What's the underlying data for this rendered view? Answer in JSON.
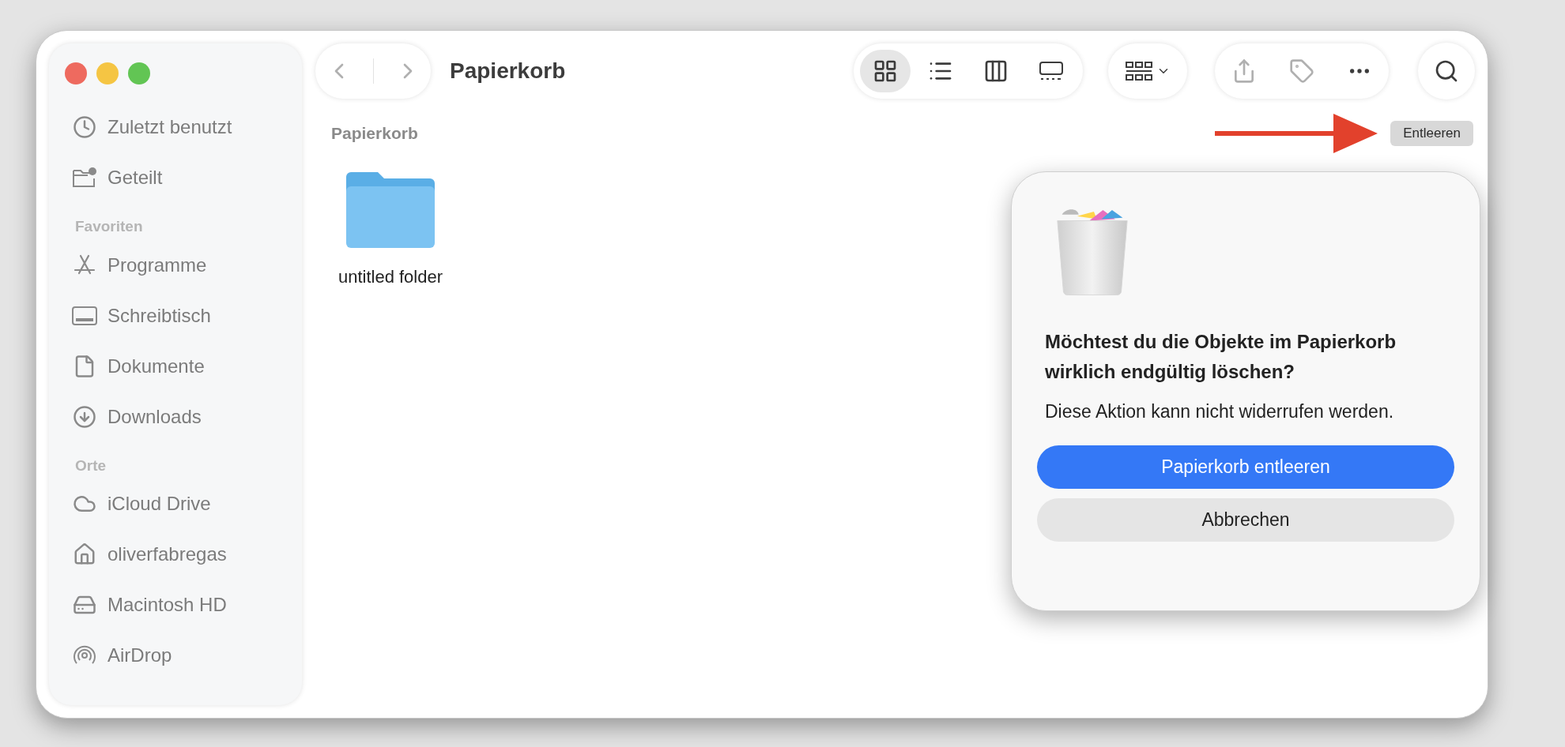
{
  "window": {
    "title": "Papierkorb"
  },
  "toolbar": {
    "view_modes": [
      {
        "selected": true
      },
      {
        "selected": false
      },
      {
        "selected": false
      },
      {
        "selected": false
      }
    ]
  },
  "sidebar": {
    "top_items": [
      {
        "label": "Zuletzt benutzt"
      },
      {
        "label": "Geteilt"
      }
    ],
    "sections": [
      {
        "title": "Favoriten",
        "items": [
          {
            "label": "Programme"
          },
          {
            "label": "Schreibtisch"
          },
          {
            "label": "Dokumente"
          },
          {
            "label": "Downloads"
          }
        ]
      },
      {
        "title": "Orte",
        "items": [
          {
            "label": "iCloud Drive"
          },
          {
            "label": "oliverfabregas"
          },
          {
            "label": "Macintosh HD"
          },
          {
            "label": "AirDrop"
          }
        ]
      }
    ]
  },
  "content": {
    "header": "Papierkorb",
    "empty_button": "Entleeren",
    "files": [
      {
        "name": "untitled folder"
      }
    ]
  },
  "dialog": {
    "title": "Möchtest du die Objekte im Papierkorb wirklich endgültig löschen?",
    "message": "Diese Aktion kann nicht widerrufen werden.",
    "buttons": [
      {
        "label": "Papierkorb entleeren",
        "kind": "primary"
      },
      {
        "label": "Abbrechen",
        "kind": "secondary"
      }
    ]
  }
}
